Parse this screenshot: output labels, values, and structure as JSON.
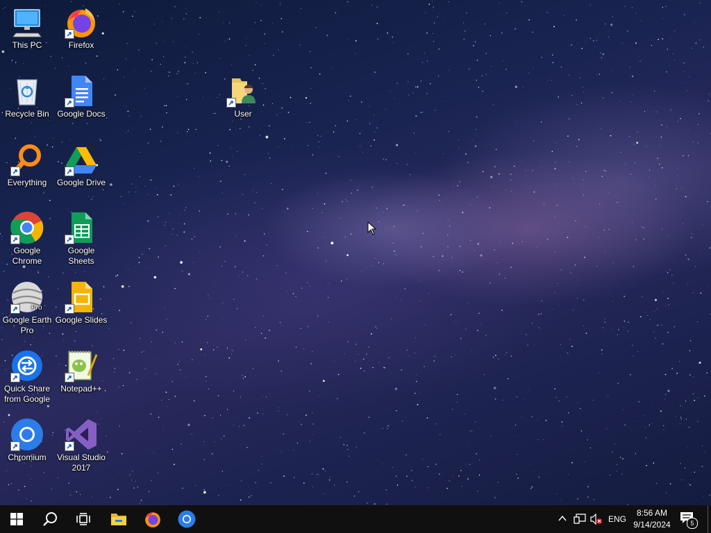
{
  "desktop": {
    "icons": {
      "this_pc": "This PC",
      "firefox": "Firefox",
      "recycle_bin": "Recycle Bin",
      "google_docs": "Google Docs",
      "user": "User",
      "everything": "Everything",
      "google_drive": "Google Drive",
      "google_chrome": "Google Chrome",
      "google_sheets": "Google Sheets",
      "google_earth_pro": "Google Earth Pro",
      "google_slides": "Google Slides",
      "quick_share": "Quick Share from Google",
      "notepadpp": "Notepad++",
      "chromium": "Chromium",
      "visual_studio": "Visual Studio 2017"
    },
    "earth_badge": "Pro"
  },
  "taskbar": {
    "start_icon": "windows-logo-icon",
    "search_icon": "search-icon",
    "taskview_icon": "task-view-icon",
    "pinned": [
      "file-explorer-icon",
      "firefox-icon",
      "chromium-icon"
    ],
    "tray": {
      "language": "ENG",
      "time": "8:56 AM",
      "date": "9/14/2024",
      "notification_count": "5"
    }
  },
  "colors": {
    "taskbar_bg": "#101010",
    "desktop_bg": "#1a2452"
  }
}
